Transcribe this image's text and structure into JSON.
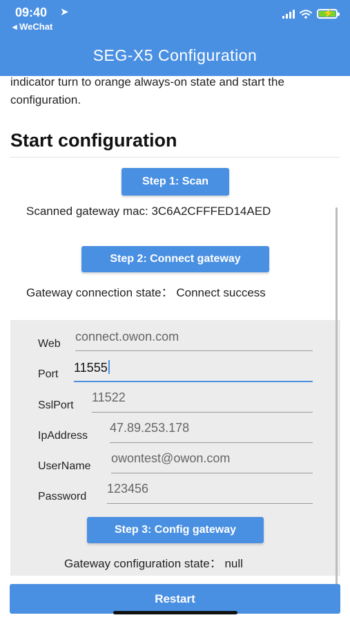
{
  "status_bar": {
    "time": "09:40",
    "location_icon": "location-arrow-icon",
    "back_app": "◂ WeChat",
    "battery_color": "#7ed321"
  },
  "header": {
    "title": "SEG-X5 Configuration",
    "background": "#4a90e2"
  },
  "intro": {
    "text": "indicator turn to orange always-on state and start the configuration."
  },
  "section": {
    "title": "Start configuration"
  },
  "steps": {
    "scan_label": "Step 1: Scan",
    "scanned_text": "Scanned gateway mac: 3C6A2CFFFED14AED",
    "connect_label": "Step 2: Connect gateway",
    "connection_state_text": "Gateway connection state：  Connect success",
    "config_label": "Step 3: Config gateway",
    "config_state_text": "Gateway configuration state：  null"
  },
  "form": {
    "web": {
      "label": "Web",
      "value": "connect.owon.com"
    },
    "port": {
      "label": "Port",
      "value": "11555"
    },
    "sslport": {
      "label": "SslPort",
      "value": "11522"
    },
    "ipaddress": {
      "label": "IpAddress",
      "value": "47.89.253.178"
    },
    "username": {
      "label": "UserName",
      "value": "owontest@owon.com"
    },
    "password": {
      "label": "Password",
      "value": "123456"
    }
  },
  "footer": {
    "restart_label": "Restart"
  }
}
